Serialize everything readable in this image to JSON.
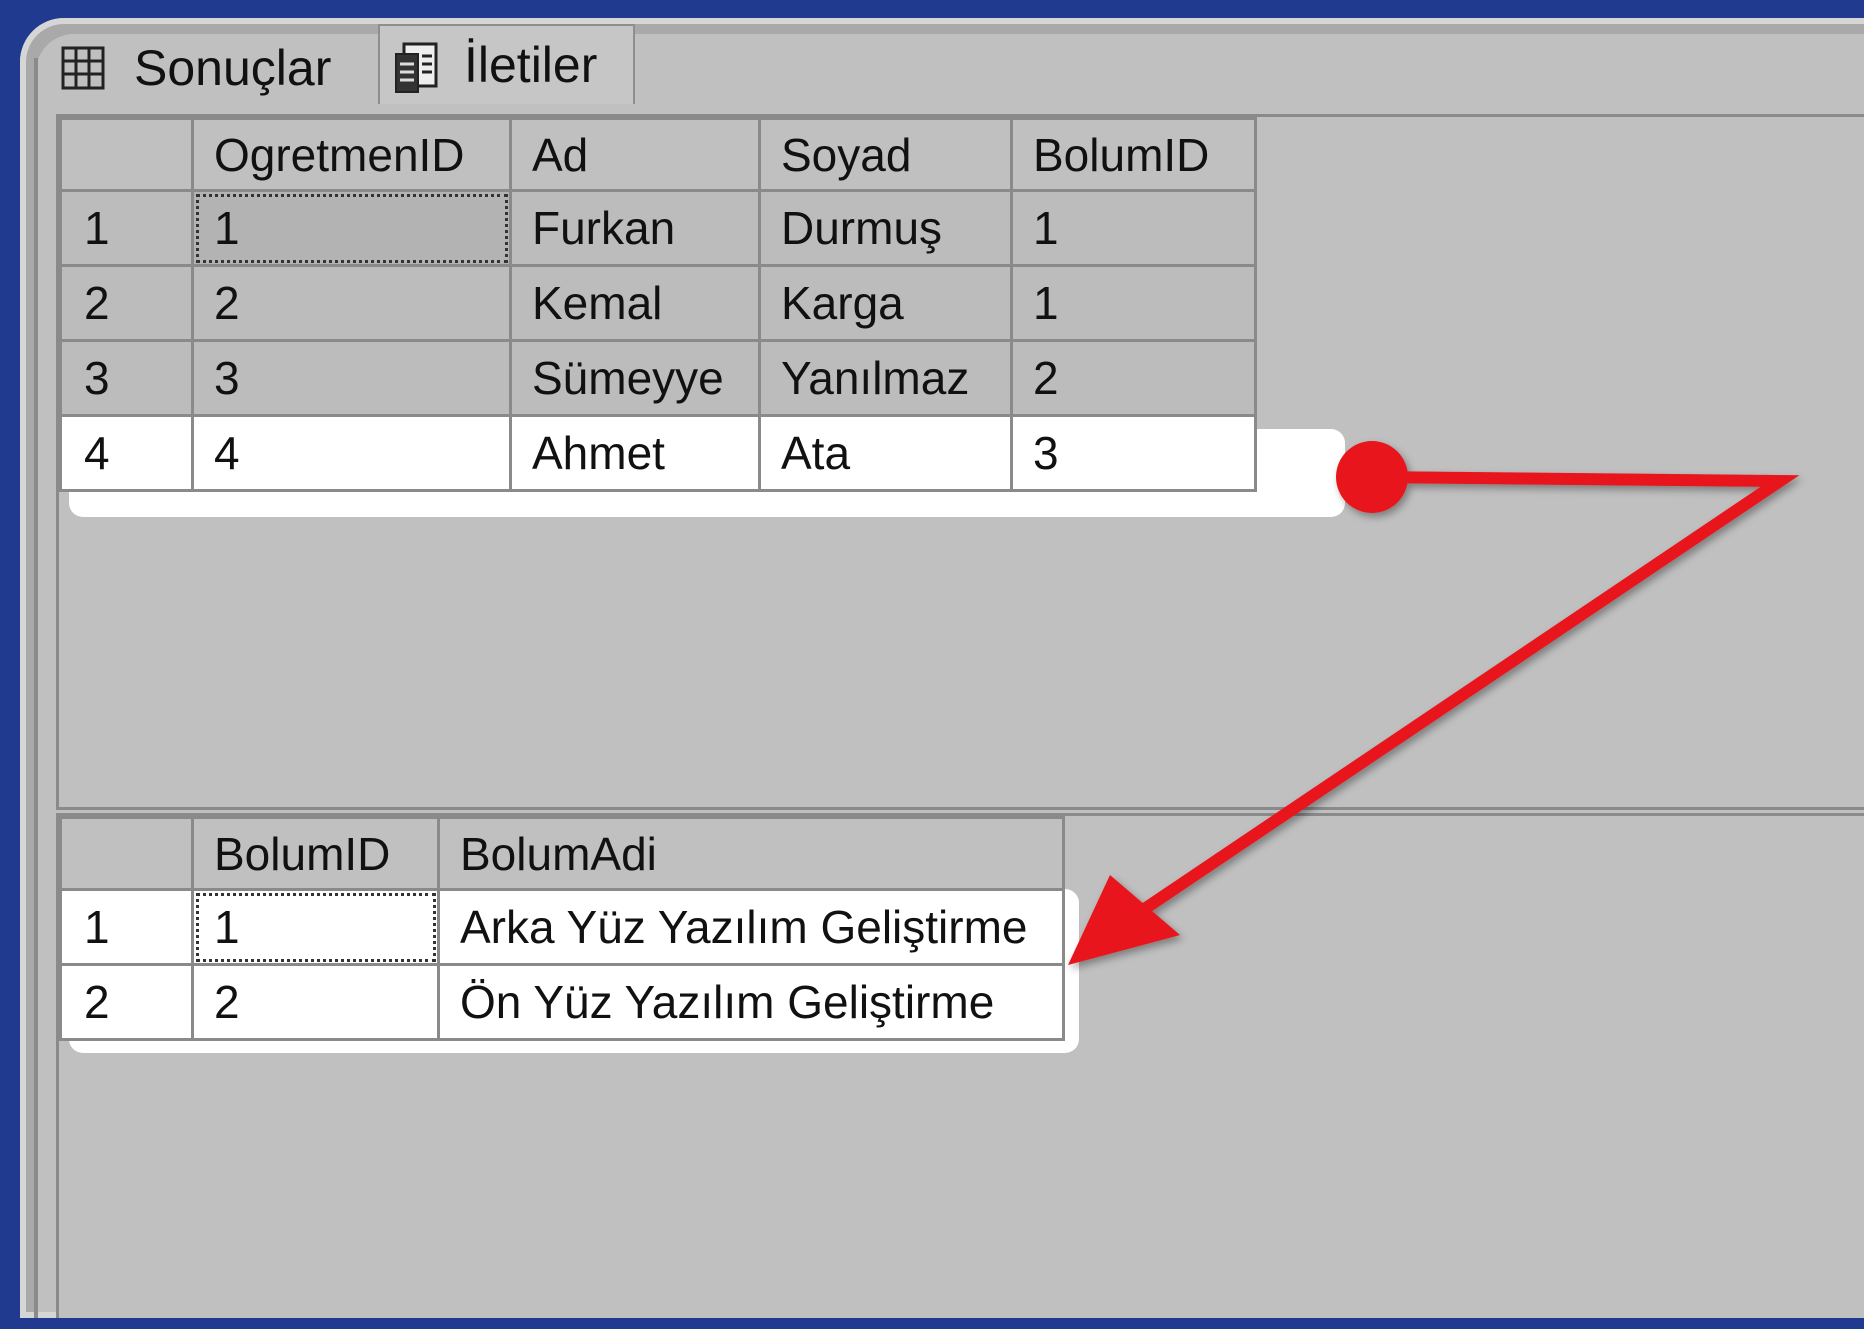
{
  "tabs": {
    "results": {
      "label": "Sonuçlar",
      "icon": "grid-icon"
    },
    "messages": {
      "label": "İletiler",
      "icon": "messages-document-icon"
    }
  },
  "grid1": {
    "columns": [
      "OgretmenID",
      "Ad",
      "Soyad",
      "BolumID"
    ],
    "rows": [
      {
        "n": "1",
        "cells": [
          "1",
          "Furkan",
          "Durmuş",
          "1"
        ]
      },
      {
        "n": "2",
        "cells": [
          "2",
          "Kemal",
          "Karga",
          "1"
        ]
      },
      {
        "n": "3",
        "cells": [
          "3",
          "Sümeyye",
          "Yanılmaz",
          "2"
        ]
      },
      {
        "n": "4",
        "cells": [
          "4",
          "Ahmet",
          "Ata",
          "3"
        ]
      }
    ]
  },
  "grid2": {
    "columns": [
      "BolumID",
      "BolumAdi"
    ],
    "rows": [
      {
        "n": "1",
        "cells": [
          "1",
          "Arka Yüz Yazılım Geliştirme"
        ]
      },
      {
        "n": "2",
        "cells": [
          "2",
          "Ön Yüz Yazılım Geliştirme"
        ]
      }
    ]
  },
  "colors": {
    "annotation": "#e8141b",
    "background": "#1f3a8f",
    "panel": "#c0c0c0"
  }
}
